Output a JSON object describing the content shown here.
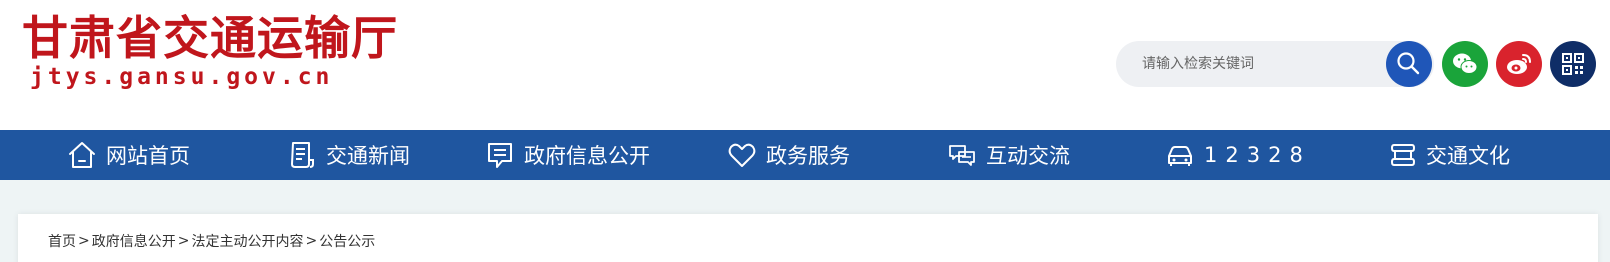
{
  "header": {
    "site_title": "甘肃省交通运输厅",
    "site_domain": "jtys.gansu.gov.cn"
  },
  "search": {
    "placeholder": "请输入检索关键词"
  },
  "social": {
    "search_icon": "search-icon",
    "wechat_icon": "wechat-icon",
    "weibo_icon": "weibo-icon",
    "qr_icon": "qrcode-icon"
  },
  "colors": {
    "brand_red": "#c0161c",
    "nav_blue": "#1f56a0",
    "search_blue": "#1f56b8",
    "wechat_green": "#1aa43a",
    "weibo_red": "#d9232d",
    "qr_navy": "#0f2d67",
    "page_bg": "#eef4f5"
  },
  "nav": {
    "items": [
      {
        "label": "网站首页",
        "icon": "home-icon"
      },
      {
        "label": "交通新闻",
        "icon": "news-document-icon"
      },
      {
        "label": "政府信息公开",
        "icon": "message-board-icon"
      },
      {
        "label": "政务服务",
        "icon": "heart-icon"
      },
      {
        "label": "互动交流",
        "icon": "chat-bubbles-icon"
      },
      {
        "label": "12328",
        "icon": "car-icon"
      },
      {
        "label": "交通文化",
        "icon": "scroll-icon"
      }
    ]
  },
  "breadcrumb": {
    "items": [
      "首页",
      "政府信息公开",
      "法定主动公开内容",
      "公告公示"
    ],
    "separator": ">"
  }
}
